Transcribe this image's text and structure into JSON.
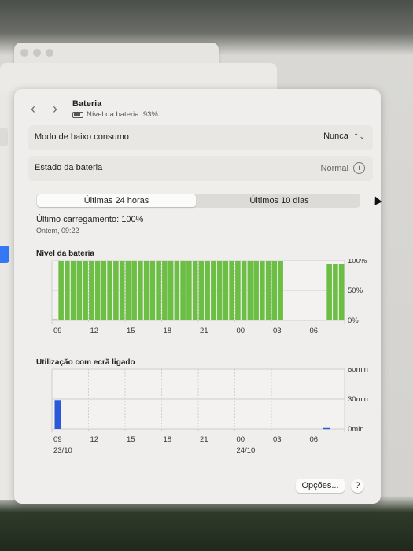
{
  "header": {
    "back_glyph": "‹",
    "forward_glyph": "›",
    "title": "Bateria",
    "battery_level_text": "Nível da bateria: 93%"
  },
  "settings": {
    "low_power": {
      "label": "Modo de baixo consumo",
      "value": "Nunca",
      "stepper_glyph": "⌃⌄"
    },
    "battery_health": {
      "label": "Estado da bateria",
      "value": "Normal",
      "info_glyph": "i"
    }
  },
  "tabs": [
    {
      "label": "Últimas 24 horas",
      "active": true
    },
    {
      "label": "Últimos 10 dias",
      "active": false
    }
  ],
  "last_charge": {
    "text": "Último carregamento: 100%",
    "time": "Ontem, 09:22"
  },
  "footer": {
    "options_label": "Opções...",
    "help_label": "?"
  },
  "colors": {
    "battery_bar": "#6dbe45",
    "usage_bar": "#2a5ad8",
    "accent": "#3478f6"
  },
  "chart_data": [
    {
      "type": "bar",
      "title": "Nível da bateria",
      "x_ticks": [
        "09",
        "12",
        "15",
        "18",
        "21",
        "00",
        "03",
        "06"
      ],
      "y_ticks": [
        "100%",
        "50%",
        "0%"
      ],
      "ylim": [
        0,
        100
      ],
      "slots": 48,
      "values": [
        2,
        99,
        99,
        99,
        99,
        99,
        99,
        99,
        99,
        99,
        99,
        99,
        99,
        99,
        99,
        99,
        99,
        99,
        99,
        99,
        99,
        99,
        99,
        99,
        99,
        99,
        99,
        99,
        99,
        99,
        99,
        99,
        99,
        99,
        99,
        99,
        99,
        99,
        0,
        0,
        0,
        0,
        0,
        0,
        0,
        94,
        94,
        94,
        94,
        94,
        94
      ],
      "grid": true
    },
    {
      "type": "bar",
      "title": "Utilização com ecrã ligado",
      "x_ticks": [
        "09",
        "12",
        "15",
        "18",
        "21",
        "00",
        "03",
        "06"
      ],
      "y_ticks": [
        "60min",
        "30min",
        "0min"
      ],
      "date_labels": [
        {
          "text": "23/10",
          "at_tick": 0
        },
        {
          "text": "24/10",
          "at_tick": 5
        }
      ],
      "ylim": [
        0,
        60
      ],
      "slots": 24,
      "values": [
        29,
        0,
        0,
        0,
        0,
        0,
        0,
        0,
        0,
        0,
        0,
        0,
        0,
        0,
        0,
        0,
        0,
        0,
        0,
        0,
        0,
        0,
        1,
        0
      ],
      "grid": true
    }
  ]
}
